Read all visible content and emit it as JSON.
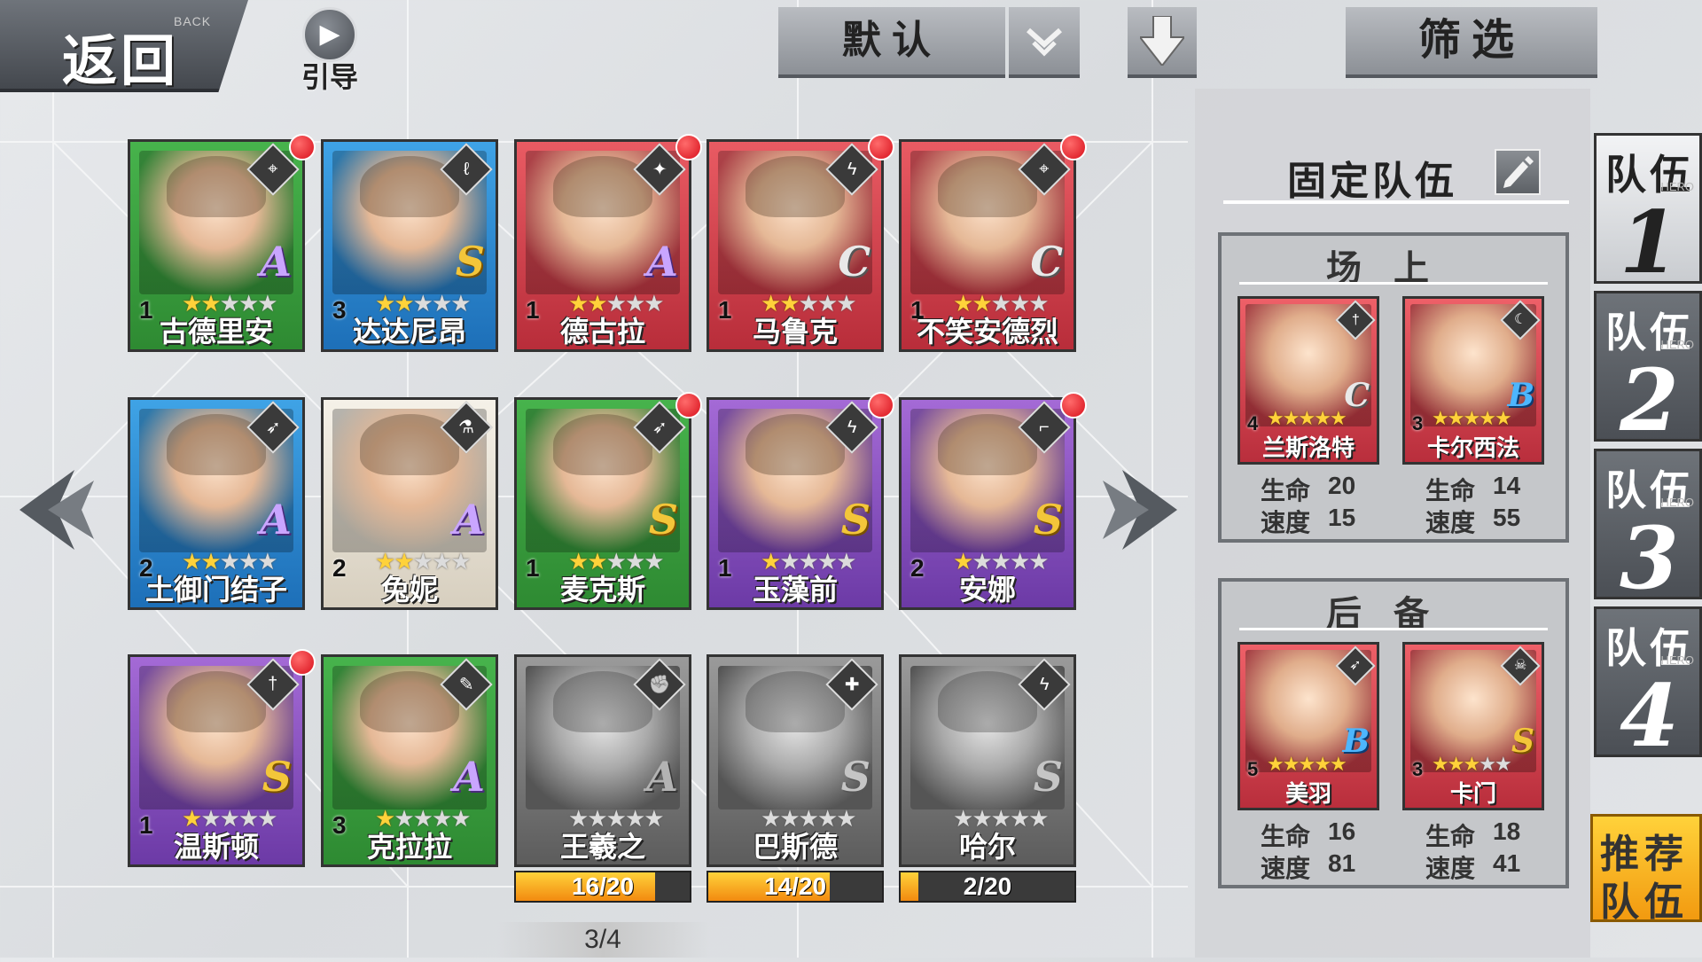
{
  "header": {
    "back_label": "返回",
    "back_sub": "BACK",
    "guide_label": "引导",
    "sort_label": "默认",
    "filter_label": "筛选"
  },
  "heroes": [
    {
      "name": "古德里安",
      "level": "1",
      "stars": 2,
      "rank": "A",
      "color": "green",
      "class_icon": "crosshair-icon",
      "glyph": "⌖",
      "red_dot": true
    },
    {
      "name": "达达尼昂",
      "level": "3",
      "stars": 2,
      "rank": "S",
      "color": "blue",
      "class_icon": "sword-icon",
      "glyph": "ℓ",
      "red_dot": false
    },
    {
      "name": "德古拉",
      "level": "1",
      "stars": 2,
      "rank": "A",
      "color": "red",
      "class_icon": "shuriken-icon",
      "glyph": "✦",
      "red_dot": true
    },
    {
      "name": "马鲁克",
      "level": "1",
      "stars": 2,
      "rank": "C",
      "color": "red",
      "class_icon": "claw-icon",
      "glyph": "ϟ",
      "red_dot": true
    },
    {
      "name": "不笑安德烈",
      "level": "1",
      "stars": 2,
      "rank": "C",
      "color": "red",
      "class_icon": "crosshair-icon",
      "glyph": "⌖",
      "red_dot": true
    },
    {
      "name": "土御门结子",
      "level": "2",
      "stars": 2,
      "rank": "A",
      "color": "blue",
      "class_icon": "bow-icon",
      "glyph": "➶",
      "red_dot": false
    },
    {
      "name": "兔妮",
      "level": "2",
      "stars": 2,
      "rank": "A",
      "color": "white",
      "class_icon": "potion-icon",
      "glyph": "⚗",
      "red_dot": false
    },
    {
      "name": "麦克斯",
      "level": "1",
      "stars": 2,
      "rank": "S",
      "color": "green",
      "class_icon": "bow-icon",
      "glyph": "➶",
      "red_dot": true
    },
    {
      "name": "玉藻前",
      "level": "1",
      "stars": 1,
      "rank": "S",
      "color": "purple",
      "class_icon": "claw-icon",
      "glyph": "ϟ",
      "red_dot": true
    },
    {
      "name": "安娜",
      "level": "2",
      "stars": 1,
      "rank": "S",
      "color": "purple",
      "class_icon": "gun-icon",
      "glyph": "⌐",
      "red_dot": true
    },
    {
      "name": "温斯顿",
      "level": "1",
      "stars": 1,
      "rank": "S",
      "color": "purple",
      "class_icon": "sword-icon",
      "glyph": "†",
      "red_dot": true
    },
    {
      "name": "克拉拉",
      "level": "3",
      "stars": 1,
      "rank": "A",
      "color": "green",
      "class_icon": "feather-icon",
      "glyph": "✎",
      "red_dot": false
    },
    {
      "name": "王羲之",
      "level": "",
      "stars": 0,
      "rank": "A",
      "color": "gray",
      "class_icon": "fist-icon",
      "glyph": "✊",
      "red_dot": false,
      "shards": "16/20",
      "shard_ratio": 0.8
    },
    {
      "name": "巴斯德",
      "level": "",
      "stars": 0,
      "rank": "S",
      "color": "gray",
      "class_icon": "cross-icon",
      "glyph": "✚",
      "red_dot": false,
      "shards": "14/20",
      "shard_ratio": 0.7
    },
    {
      "name": "哈尔",
      "level": "",
      "stars": 0,
      "rank": "S",
      "color": "gray",
      "class_icon": "claw-icon",
      "glyph": "ϟ",
      "red_dot": false,
      "shards": "2/20",
      "shard_ratio": 0.1
    }
  ],
  "pagination": {
    "label": "3/4"
  },
  "fixed_team": {
    "title": "固定队伍",
    "on_field_title": "场上",
    "reserve_title": "后备",
    "stat_hp_label": "生命",
    "stat_speed_label": "速度",
    "on_field": [
      {
        "name": "兰斯洛特",
        "level": "4",
        "stars": 5,
        "rank": "C",
        "class_icon": "sword-icon",
        "glyph": "†",
        "hp": "20",
        "speed": "15"
      },
      {
        "name": "卡尔西法",
        "level": "3",
        "stars": 5,
        "rank": "B",
        "class_icon": "moon-icon",
        "glyph": "☾",
        "hp": "14",
        "speed": "55"
      }
    ],
    "reserve": [
      {
        "name": "美羽",
        "level": "5",
        "stars": 5,
        "rank": "B",
        "class_icon": "bow-icon",
        "glyph": "➶",
        "hp": "16",
        "speed": "81"
      },
      {
        "name": "卡门",
        "level": "3",
        "stars": 3,
        "rank": "S",
        "class_icon": "mask-icon",
        "glyph": "☠",
        "hp": "18",
        "speed": "41"
      }
    ]
  },
  "team_tabs": [
    {
      "label": "队伍",
      "hero": "HERO",
      "number": "1",
      "active": true
    },
    {
      "label": "队伍",
      "hero": "HERO",
      "number": "2",
      "active": false
    },
    {
      "label": "队伍",
      "hero": "HERO",
      "number": "3",
      "active": false
    },
    {
      "label": "队伍",
      "hero": "HERO",
      "number": "4",
      "active": false
    }
  ],
  "recommend": {
    "line1": "推荐",
    "line2": "队伍"
  }
}
